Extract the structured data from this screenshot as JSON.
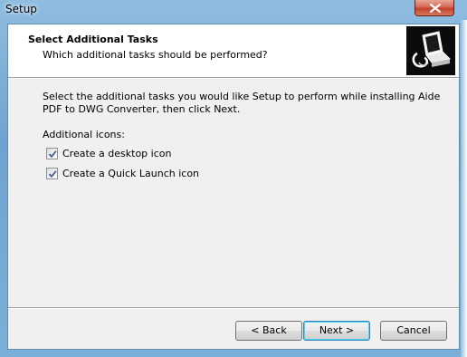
{
  "window": {
    "title": "Setup"
  },
  "header": {
    "title": "Select Additional Tasks",
    "subtitle": "Which additional tasks should be performed?"
  },
  "body": {
    "description": "Select the additional tasks you would like Setup to perform while installing Aide PDF to DWG Converter, then click Next.",
    "group_label": "Additional icons:",
    "tasks": [
      {
        "label": "Create a desktop icon",
        "checked": true
      },
      {
        "label": "Create a Quick Launch icon",
        "checked": true
      }
    ]
  },
  "buttons": {
    "back": "< Back",
    "next": "Next >",
    "cancel": "Cancel"
  },
  "icons": {
    "close": "close-icon",
    "logo": "setup-computer-icon",
    "check": "checkmark-icon"
  },
  "colors": {
    "titlebar": "#7eb0d6",
    "close_button": "#c1412b",
    "client_bg": "#f0f0f0",
    "header_bg": "#ffffff",
    "default_button_border": "#3c7fb1"
  }
}
